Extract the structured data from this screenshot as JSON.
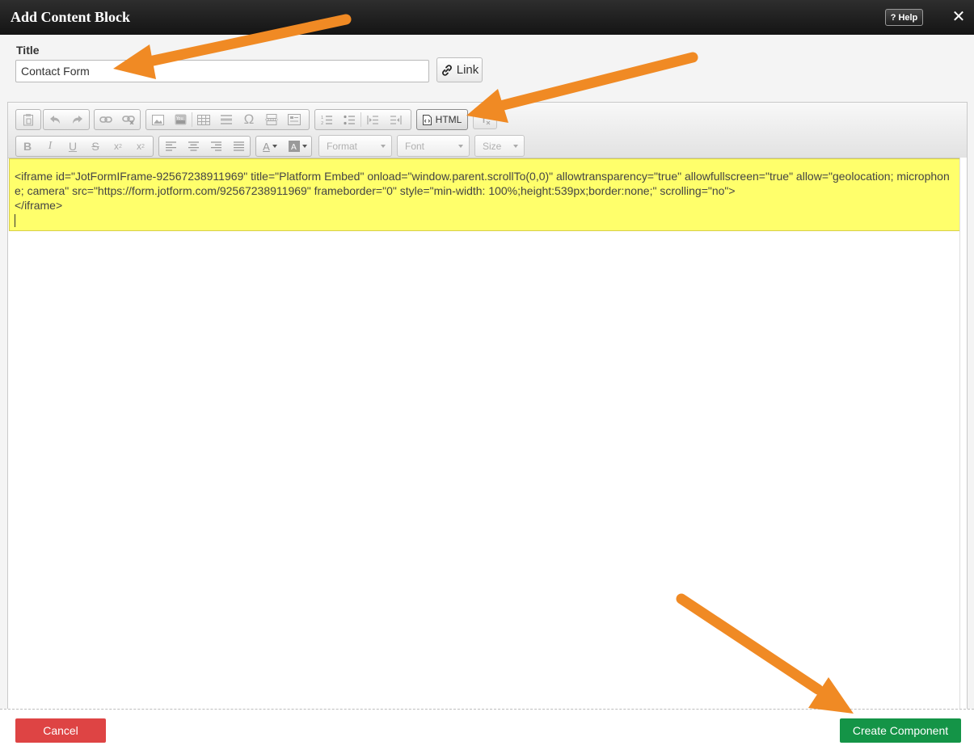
{
  "dialog": {
    "title": "Add Content Block",
    "help_label": "Help",
    "help_icon": "?"
  },
  "form": {
    "title_label": "Title",
    "title_value": "Contact Form",
    "link_label": "Link"
  },
  "toolbar": {
    "html_label": "HTML",
    "format_placeholder": "Format",
    "font_placeholder": "Font",
    "size_placeholder": "Size",
    "text_color_glyph": "A",
    "omega_glyph": "Ω",
    "strike_glyph": "S",
    "icons_row1": [
      "paste-icon",
      "undo-icon",
      "redo-icon",
      "link-icon",
      "unlink-icon",
      "image-icon",
      "youtube-icon",
      "table-icon",
      "horizontal-line-icon",
      "special-char-icon",
      "page-break-icon",
      "form-icon",
      "numbered-list-icon",
      "bulleted-list-icon",
      "outdent-icon",
      "indent-icon",
      "source-html-icon",
      "remove-format-icon"
    ],
    "icons_row2": [
      "bold-icon",
      "italic-icon",
      "underline-icon",
      "strikethrough-icon",
      "subscript-icon",
      "superscript-icon",
      "align-left-icon",
      "align-center-icon",
      "align-right-icon",
      "justify-icon",
      "text-color-icon",
      "background-color-icon"
    ]
  },
  "editor": {
    "code_line1": "<iframe id=\"JotFormIFrame-92567238911969\" title=\"Platform Embed\" onload=\"window.parent.scrollTo(0,0)\" allowtransparency=\"true\" allowfullscreen=\"true\" allow=\"geolocation; microphone; camera\" src=\"https://form.jotform.com/92567238911969\" frameborder=\"0\" style=\"min-width: 100%;height:539px;border:none;\" scrolling=\"no\">",
    "code_line2": "</iframe>"
  },
  "footer": {
    "cancel_label": "Cancel",
    "create_label": "Create Component"
  },
  "colors": {
    "annotation_arrow": "#f08a24",
    "cancel": "#de4444",
    "create": "#149447",
    "highlight": "#ffff6b"
  }
}
